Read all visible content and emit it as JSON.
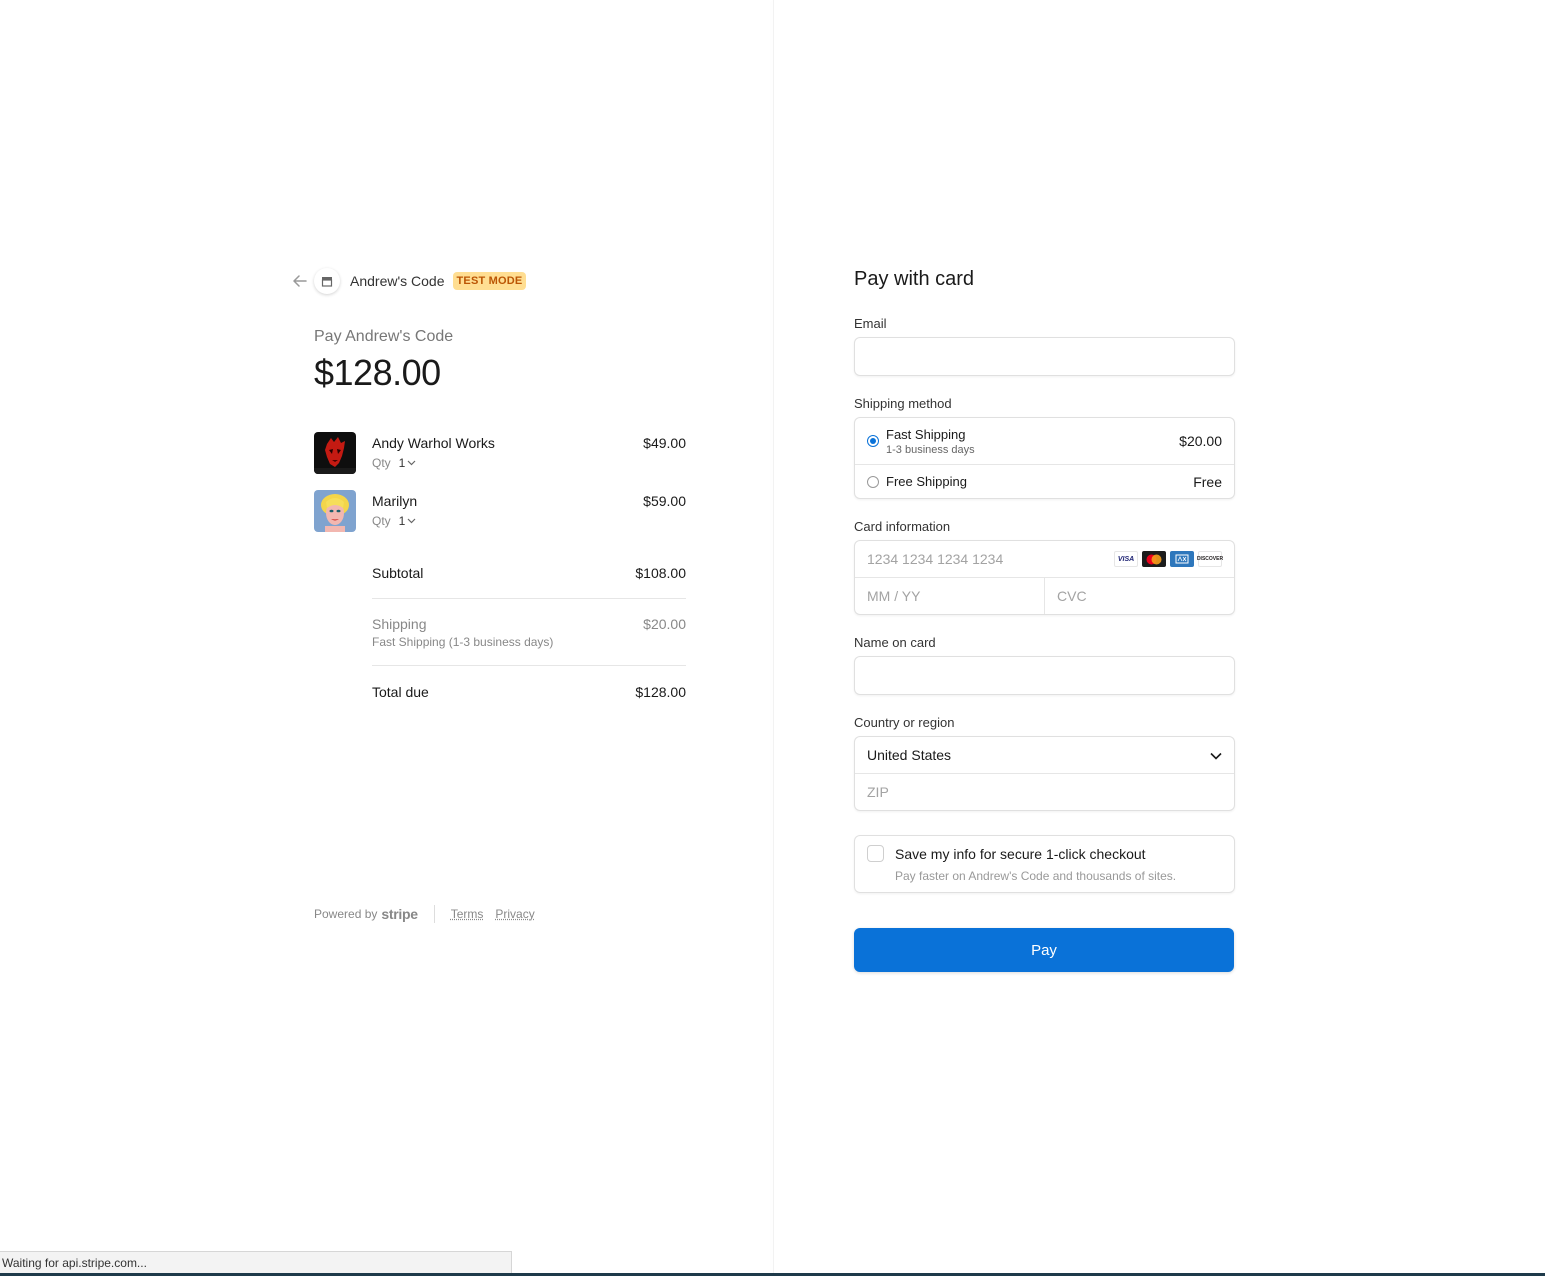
{
  "header": {
    "merchant_name": "Andrew's Code",
    "badge": "TEST MODE"
  },
  "summary": {
    "pay_label": "Pay Andrew's Code",
    "amount": "$128.00"
  },
  "items": [
    {
      "name": "Andy Warhol Works",
      "qty_label": "Qty",
      "qty": "1",
      "price": "$49.00",
      "thumb": "andy-warhol-thumbnail"
    },
    {
      "name": "Marilyn",
      "qty_label": "Qty",
      "qty": "1",
      "price": "$59.00",
      "thumb": "marilyn-thumbnail"
    }
  ],
  "totals": {
    "subtotal_label": "Subtotal",
    "subtotal_value": "$108.00",
    "shipping_label": "Shipping",
    "shipping_sub": "Fast Shipping (1-3 business days)",
    "shipping_value": "$20.00",
    "total_label": "Total due",
    "total_value": "$128.00"
  },
  "footer": {
    "powered_by": "Powered by",
    "brand": "stripe",
    "terms": "Terms",
    "privacy": "Privacy"
  },
  "form": {
    "title": "Pay with card",
    "email_label": "Email",
    "email_value": "",
    "shipping_method_label": "Shipping method",
    "shipping_options": [
      {
        "name": "Fast Shipping",
        "sub": "1-3 business days",
        "price": "$20.00",
        "selected": true
      },
      {
        "name": "Free Shipping",
        "sub": "",
        "price": "Free",
        "selected": false
      }
    ],
    "card_label": "Card information",
    "card_number_placeholder": "1234 1234 1234 1234",
    "expiry_placeholder": "MM / YY",
    "cvc_placeholder": "CVC",
    "card_brands": [
      "VISA",
      "mastercard",
      "amex",
      "DISCOVER"
    ],
    "name_label": "Name on card",
    "name_value": "",
    "country_label": "Country or region",
    "country_value": "United States",
    "zip_placeholder": "ZIP",
    "save_title": "Save my info for secure 1-click checkout",
    "save_sub": "Pay faster on Andrew's Code and thousands of sites.",
    "pay_button": "Pay"
  },
  "status_bar": {
    "text": "Waiting for api.stripe.com..."
  },
  "colors": {
    "accent": "#0a72d8",
    "badge_bg": "#ffde92",
    "badge_text": "#bb5504"
  }
}
